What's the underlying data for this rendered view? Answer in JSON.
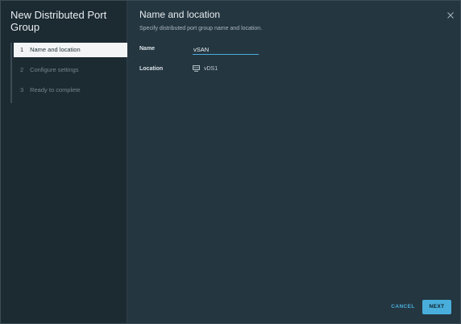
{
  "wizard": {
    "title": "New Distributed Port Group",
    "steps": [
      {
        "number": "1",
        "label": "Name and location",
        "active": true
      },
      {
        "number": "2",
        "label": "Configure settings",
        "active": false
      },
      {
        "number": "3",
        "label": "Ready to complete",
        "active": false
      }
    ]
  },
  "content": {
    "title": "Name and location",
    "subtitle": "Specify distributed port group name and location.",
    "name_label": "Name",
    "name_value": "vSAN",
    "location_label": "Location",
    "location_value": "vDS1",
    "location_icon": "distributed-switch-icon"
  },
  "footer": {
    "cancel_label": "CANCEL",
    "next_label": "NEXT"
  },
  "colors": {
    "accent": "#49aedc",
    "nav_background": "#1c2a32",
    "content_background": "#243640",
    "active_step_background": "#f2f4f5"
  }
}
